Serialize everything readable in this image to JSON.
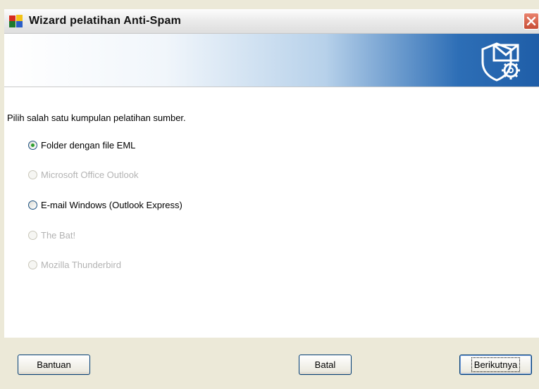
{
  "window": {
    "title": "Wizard pelatihan Anti-Spam"
  },
  "content": {
    "prompt": "Pilih salah satu kumpulan pelatihan sumber.",
    "options": [
      {
        "label": "Folder dengan file EML",
        "selected": true,
        "enabled": true
      },
      {
        "label": "Microsoft Office Outlook",
        "selected": false,
        "enabled": false
      },
      {
        "label": "E-mail Windows (Outlook Express)",
        "selected": false,
        "enabled": true
      },
      {
        "label": "The Bat!",
        "selected": false,
        "enabled": false
      },
      {
        "label": "Mozilla Thunderbird",
        "selected": false,
        "enabled": false
      }
    ]
  },
  "buttons": {
    "help": "Bantuan",
    "cancel": "Batal",
    "next": "Berikutnya"
  },
  "icons": {
    "app": "avg-logo-icon",
    "banner": "shield-envelope-gear-icon",
    "close": "close-icon"
  },
  "colors": {
    "close": "#c74d35",
    "banner_accent": "#1f5ea8",
    "radio_dot": "#2ea02e"
  }
}
